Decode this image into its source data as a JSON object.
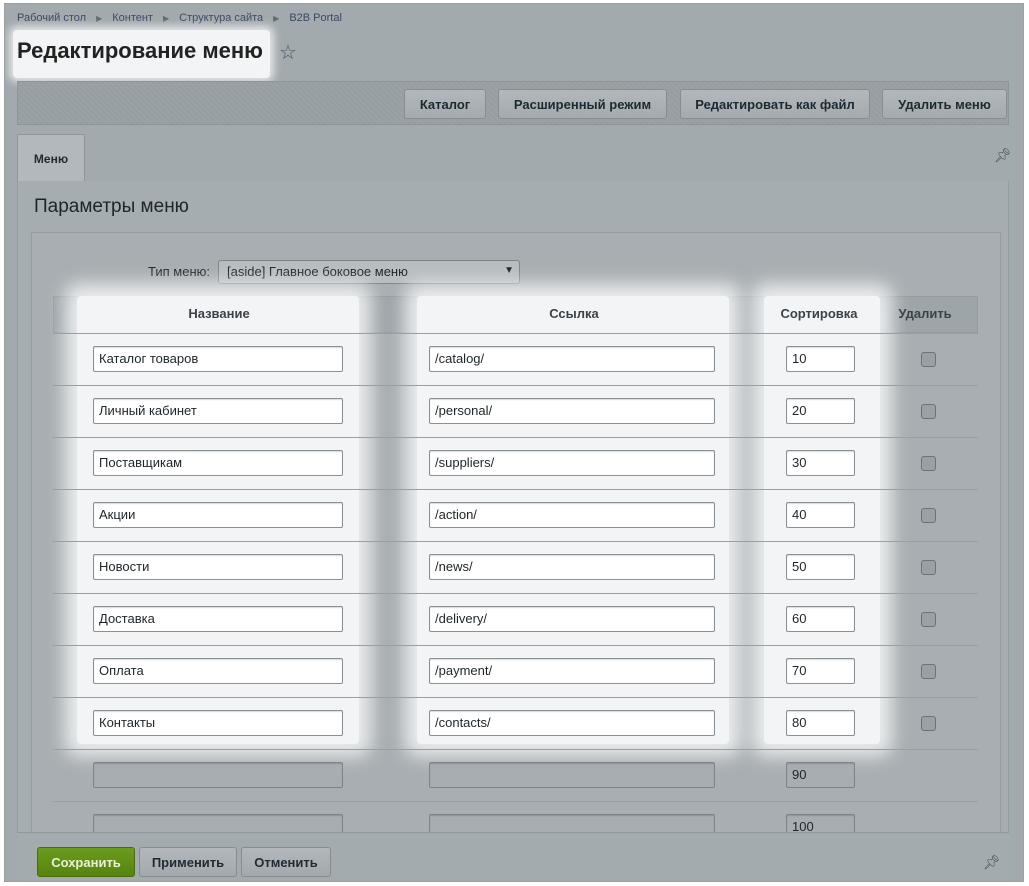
{
  "breadcrumb": [
    "Рабочий стол",
    "Контент",
    "Структура сайта",
    "B2B Portal"
  ],
  "page": {
    "title": "Редактирование меню"
  },
  "toolbar": {
    "buttons": [
      "Каталог",
      "Расширенный режим",
      "Редактировать как файл",
      "Удалить меню"
    ]
  },
  "tabs": [
    {
      "label": "Меню",
      "active": true
    }
  ],
  "section": {
    "title": "Параметры меню"
  },
  "menu_type": {
    "label": "Тип меню:",
    "value": "[aside] Главное боковое меню"
  },
  "table": {
    "headers": {
      "name": "Название",
      "link": "Ссылка",
      "sort": "Сортировка",
      "delete": "Удалить"
    },
    "rows": [
      {
        "name": "Каталог товаров",
        "link": "/catalog/",
        "sort": "10"
      },
      {
        "name": "Личный кабинет",
        "link": "/personal/",
        "sort": "20"
      },
      {
        "name": "Поставщикам",
        "link": "/suppliers/",
        "sort": "30"
      },
      {
        "name": "Акции",
        "link": "/action/",
        "sort": "40"
      },
      {
        "name": "Новости",
        "link": "/news/",
        "sort": "50"
      },
      {
        "name": "Доставка",
        "link": "/delivery/",
        "sort": "60"
      },
      {
        "name": "Оплата",
        "link": "/payment/",
        "sort": "70"
      },
      {
        "name": "Контакты",
        "link": "/contacts/",
        "sort": "80"
      },
      {
        "name": "",
        "link": "",
        "sort": "90"
      },
      {
        "name": "",
        "link": "",
        "sort": "100"
      }
    ]
  },
  "footer": {
    "save": "Сохранить",
    "apply": "Применить",
    "cancel": "Отменить"
  },
  "colors": {
    "save_button": "#5a8a12",
    "overlay": "#a3aaad",
    "highlight": "#f2f4f5"
  },
  "icons": {
    "favorite": "star-outline-icon",
    "pin": "pin-icon",
    "dropdown": "triangle-down-icon",
    "breadcrumb_separator": "triangle-right-icon"
  }
}
